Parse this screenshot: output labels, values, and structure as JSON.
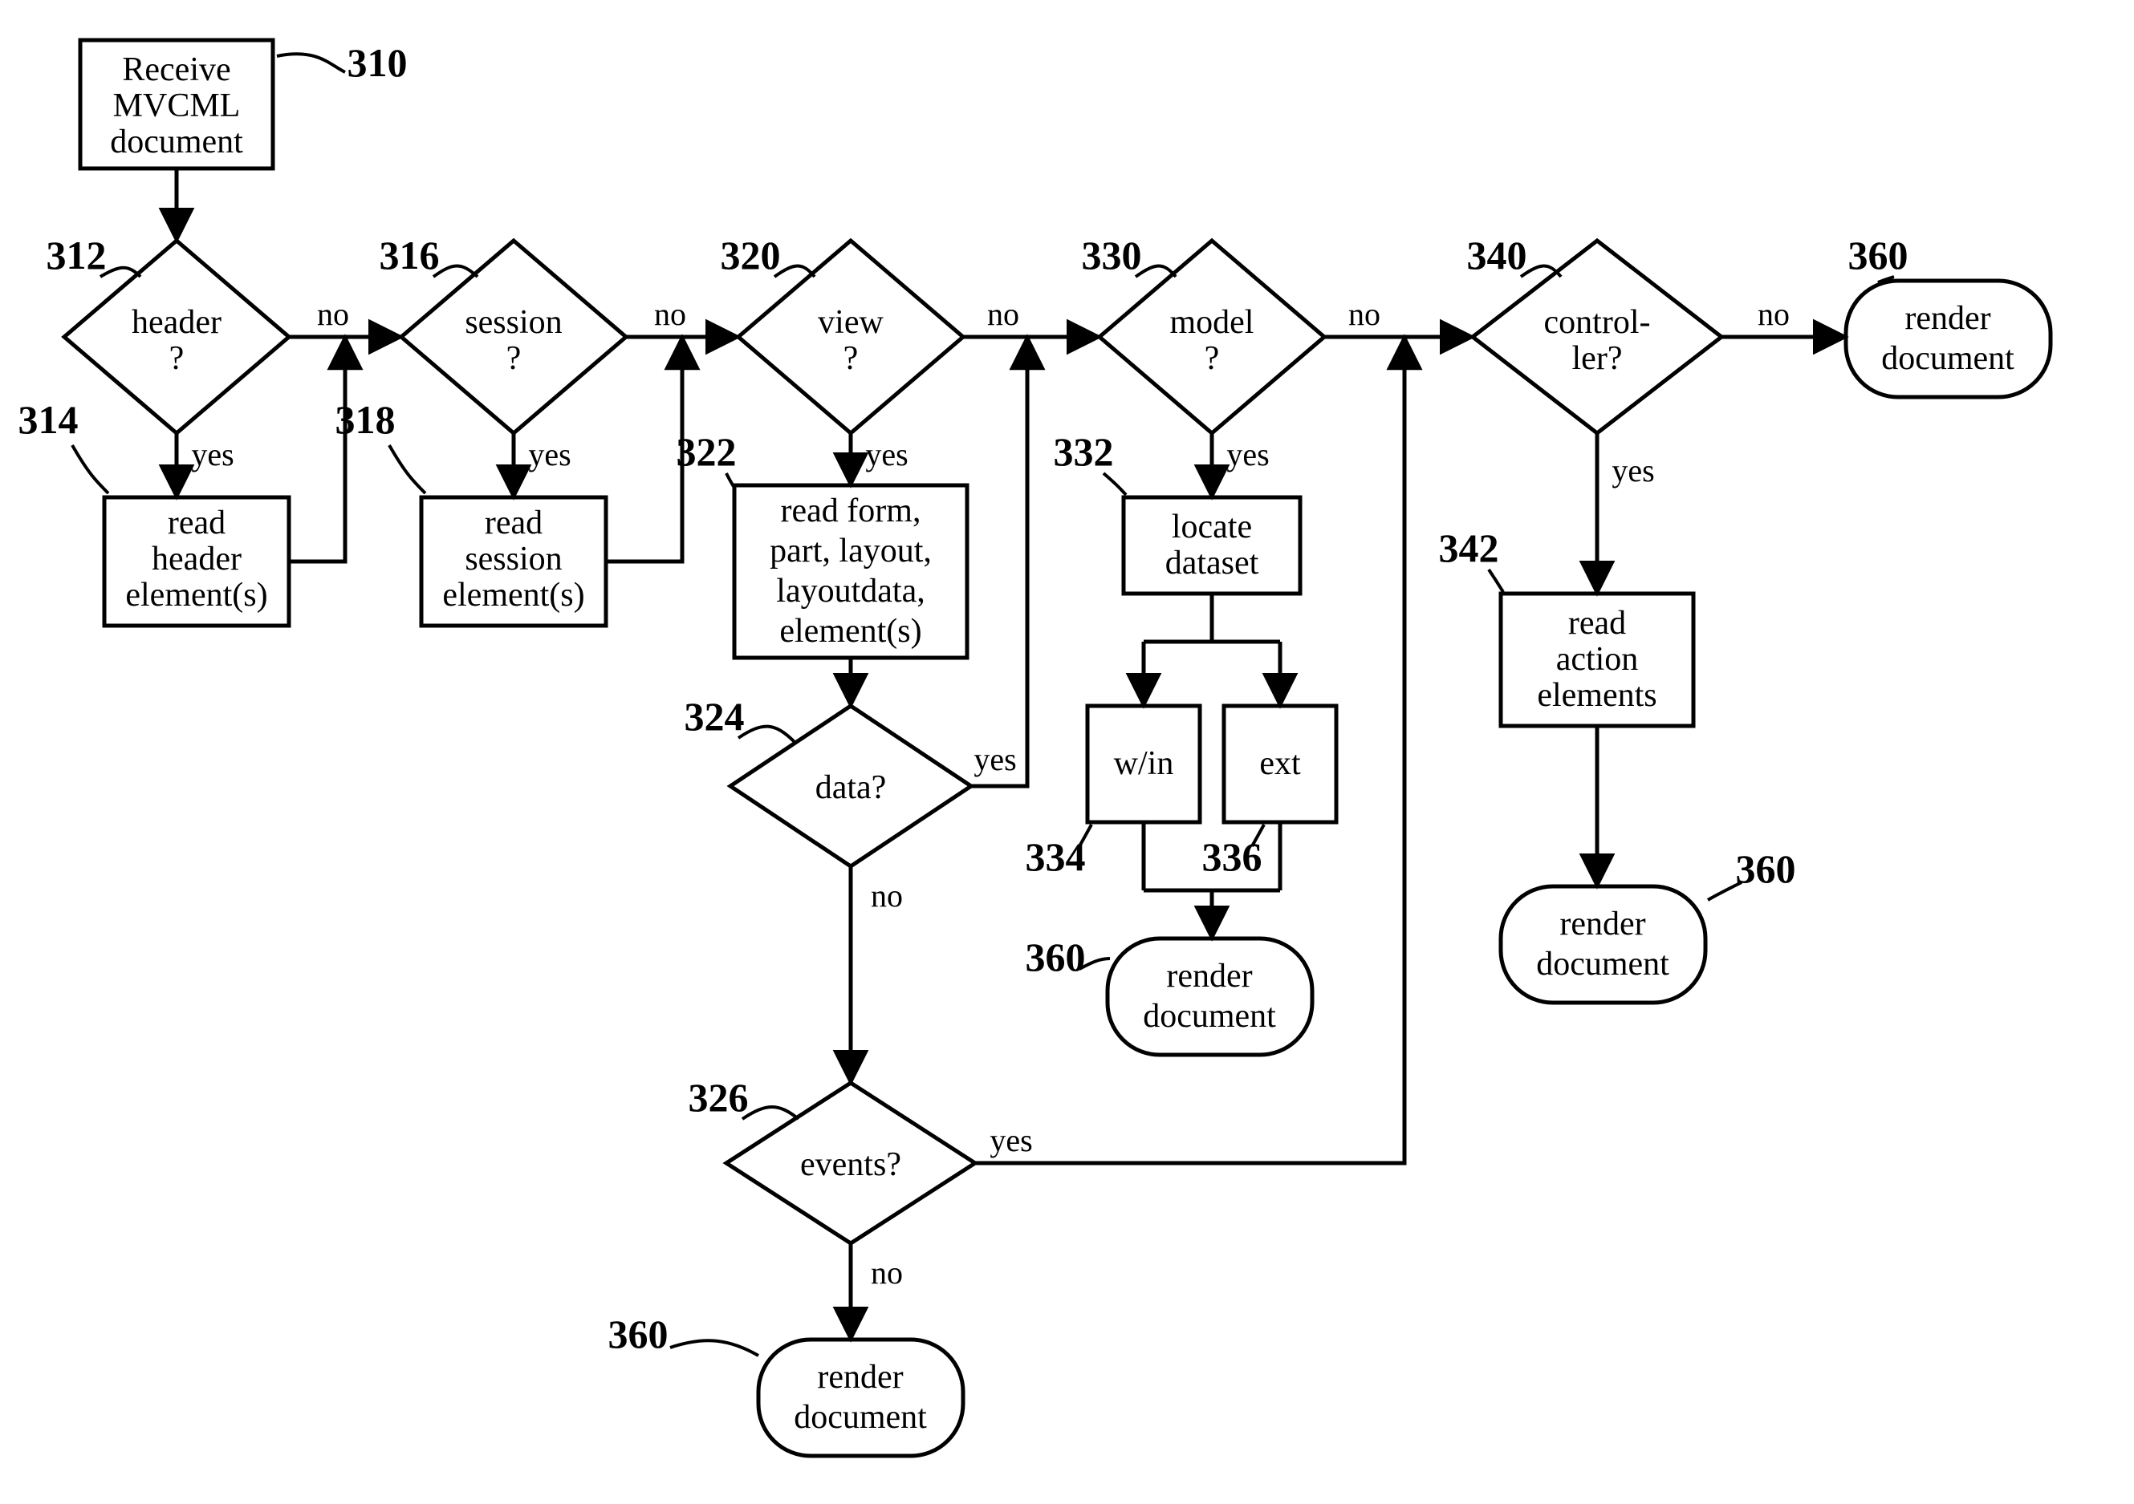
{
  "refs": {
    "n310": "310",
    "n312": "312",
    "n314": "314",
    "n316": "316",
    "n318": "318",
    "n320": "320",
    "n322": "322",
    "n324": "324",
    "n326": "326",
    "n330": "330",
    "n332": "332",
    "n334": "334",
    "n336": "336",
    "n340": "340",
    "n342": "342",
    "n360": "360"
  },
  "labels": {
    "yes": "yes",
    "no": "no"
  },
  "nodes": {
    "start": {
      "line1": "Receive",
      "line2": "MVCML",
      "line3": "document"
    },
    "d_header": {
      "line1": "header",
      "line2": "?"
    },
    "p_header": {
      "line1": "read",
      "line2": "header",
      "line3": "element(s)"
    },
    "d_session": {
      "line1": "session",
      "line2": "?"
    },
    "p_session": {
      "line1": "read",
      "line2": "session",
      "line3": "element(s)"
    },
    "d_view": {
      "line1": "view",
      "line2": "?"
    },
    "p_view": {
      "line1": "read form,",
      "line2": "part, layout,",
      "line3": "layoutdata,",
      "line4": "element(s)"
    },
    "d_data": {
      "line1": "data?"
    },
    "d_events": {
      "line1": "events?"
    },
    "d_model": {
      "line1": "model",
      "line2": "?"
    },
    "p_locate": {
      "line1": "locate",
      "line2": "dataset"
    },
    "p_win": {
      "line1": "w/in"
    },
    "p_ext": {
      "line1": "ext"
    },
    "d_controller": {
      "line1": "control-",
      "line2": "ler?"
    },
    "p_actions": {
      "line1": "read",
      "line2": "action",
      "line3": "elements"
    },
    "term_render": {
      "line1": "render",
      "line2": "document"
    }
  }
}
